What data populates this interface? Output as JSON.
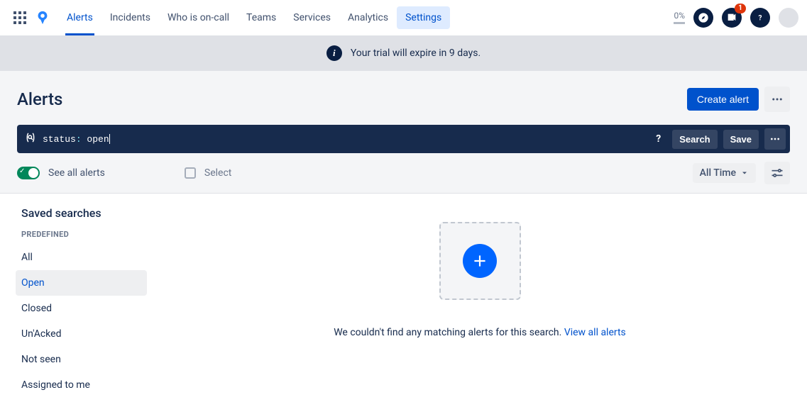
{
  "nav": {
    "tabs": [
      "Alerts",
      "Incidents",
      "Who is on-call",
      "Teams",
      "Services",
      "Analytics",
      "Settings"
    ],
    "active_index": 0,
    "highlight_index": 6,
    "progress": "0%",
    "notif_count": "1"
  },
  "banner": {
    "text": "Your trial will expire in 9 days."
  },
  "page": {
    "title": "Alerts",
    "create_btn": "Create alert"
  },
  "search": {
    "key": "status",
    "value": "open",
    "search_btn": "Search",
    "save_btn": "Save",
    "help": "?"
  },
  "toolbar": {
    "see_all": "See all alerts",
    "select": "Select",
    "time": "All Time"
  },
  "sidebar": {
    "title": "Saved searches",
    "subheader": "PREDEFINED",
    "items": [
      "All",
      "Open",
      "Closed",
      "Un'Acked",
      "Not seen",
      "Assigned to me"
    ],
    "selected_index": 1
  },
  "empty": {
    "msg": "We couldn't find any matching alerts for this search. ",
    "link": "View all alerts"
  }
}
